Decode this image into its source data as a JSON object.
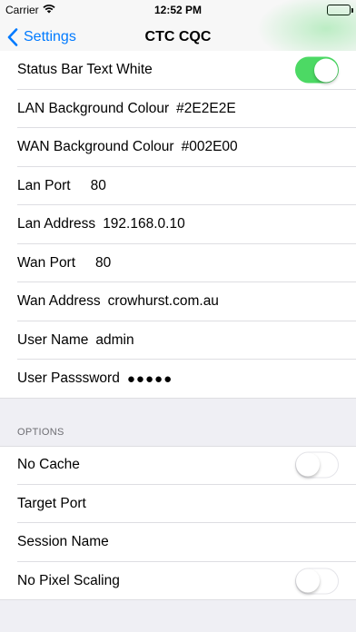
{
  "status_bar": {
    "carrier": "Carrier",
    "time": "12:52 PM"
  },
  "nav": {
    "back_label": "Settings",
    "title": "CTC CQC"
  },
  "settings": {
    "status_bar_text_white": {
      "label": "Status Bar Text White",
      "enabled": true
    },
    "lan_background": {
      "label": "LAN Background Colour",
      "value": "#2E2E2E"
    },
    "wan_background": {
      "label": "WAN Background Colour",
      "value": "#002E00"
    },
    "lan_port": {
      "label": "Lan Port",
      "value": "80"
    },
    "lan_address": {
      "label": "Lan Address",
      "value": "192.168.0.10"
    },
    "wan_port": {
      "label": "Wan Port",
      "value": "80"
    },
    "wan_address": {
      "label": "Wan Address",
      "value": "crowhurst.com.au"
    },
    "user_name": {
      "label": "User Name",
      "value": "admin"
    },
    "user_password": {
      "label": "User Passsword",
      "value": "●●●●●"
    }
  },
  "options": {
    "header": "OPTIONS",
    "no_cache": {
      "label": "No Cache",
      "enabled": false
    },
    "target_port": {
      "label": "Target Port"
    },
    "session_name": {
      "label": "Session Name"
    },
    "no_pixel_scaling": {
      "label": "No Pixel Scaling",
      "enabled": false
    }
  },
  "colors": {
    "accent": "#007aff",
    "toggle_on": "#4cd964",
    "background": "#efeff4"
  }
}
